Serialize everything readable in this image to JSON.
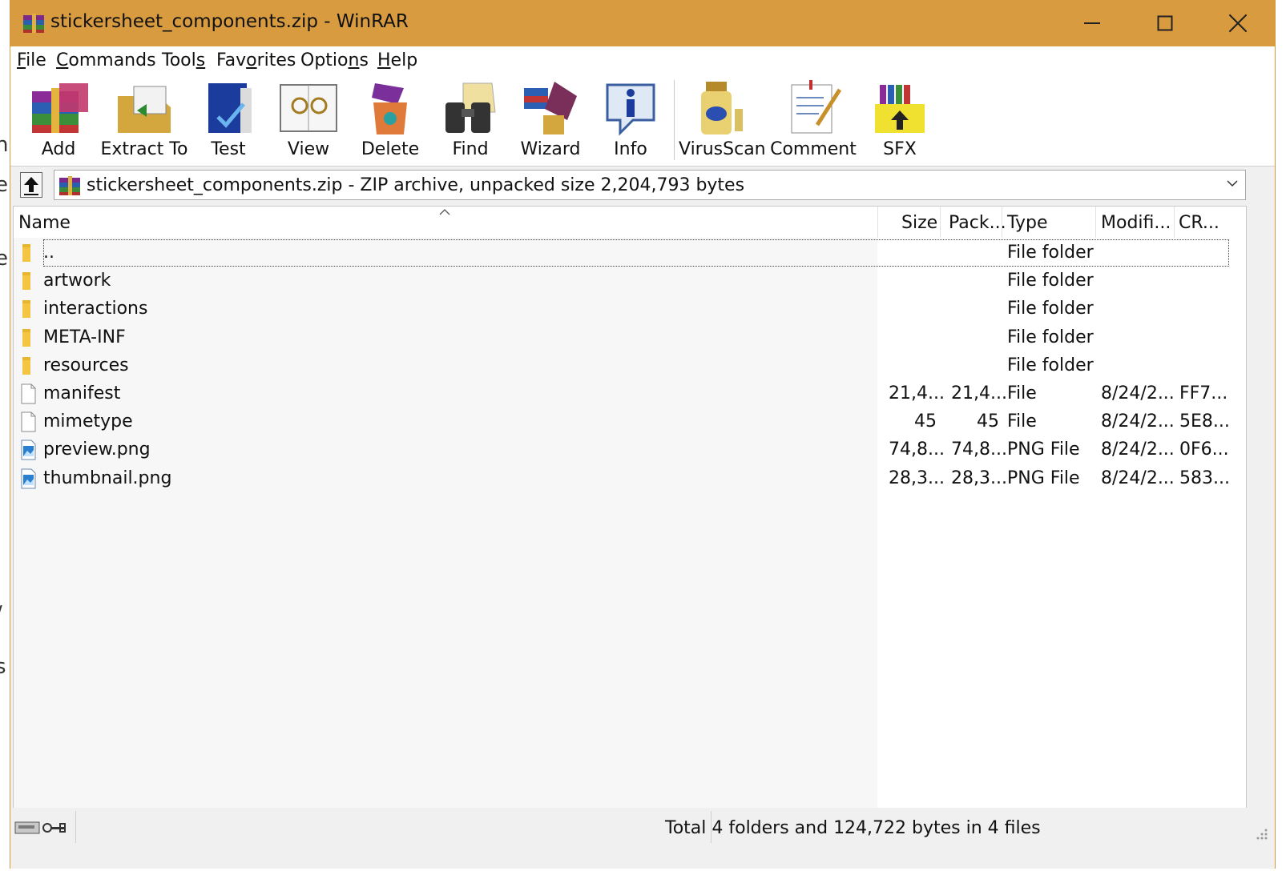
{
  "window": {
    "title": "stickersheet_components.zip - WinRAR"
  },
  "menu": [
    {
      "label": "File",
      "ul": "F",
      "rest": "ile"
    },
    {
      "label": "Commands",
      "ul": "C",
      "rest": "ommands"
    },
    {
      "label": "Tools",
      "pre": "Tool",
      "ul": "s",
      "rest": ""
    },
    {
      "label": "Favorites",
      "pre": "Fav",
      "ul": "o",
      "rest": "rites"
    },
    {
      "label": "Options",
      "pre": "Optio",
      "ul": "n",
      "rest": "s"
    },
    {
      "label": "Help",
      "ul": "H",
      "rest": "elp"
    }
  ],
  "toolbar": {
    "add": "Add",
    "extract_to": "Extract To",
    "test": "Test",
    "view": "View",
    "delete": "Delete",
    "find": "Find",
    "wizard": "Wizard",
    "info": "Info",
    "virusscan": "VirusScan",
    "comment": "Comment",
    "sfx": "SFX"
  },
  "address": {
    "text": "stickersheet_components.zip - ZIP archive, unpacked size 2,204,793 bytes"
  },
  "columns": {
    "name": "Name",
    "size": "Size",
    "packed": "Pack...",
    "type": "Type",
    "modified": "Modifi...",
    "crc": "CR..."
  },
  "files": [
    {
      "name": "..",
      "size": "",
      "packed": "",
      "type": "File folder",
      "modified": "",
      "crc": "",
      "icon": "folder-icon"
    },
    {
      "name": "artwork",
      "size": "",
      "packed": "",
      "type": "File folder",
      "modified": "",
      "crc": "",
      "icon": "folder-icon"
    },
    {
      "name": "interactions",
      "size": "",
      "packed": "",
      "type": "File folder",
      "modified": "",
      "crc": "",
      "icon": "folder-icon"
    },
    {
      "name": "META-INF",
      "size": "",
      "packed": "",
      "type": "File folder",
      "modified": "",
      "crc": "",
      "icon": "folder-icon"
    },
    {
      "name": "resources",
      "size": "",
      "packed": "",
      "type": "File folder",
      "modified": "",
      "crc": "",
      "icon": "folder-icon"
    },
    {
      "name": "manifest",
      "size": "21,4...",
      "packed": "21,4...",
      "type": "File",
      "modified": "8/24/2...",
      "crc": "FF7...",
      "icon": "file-icon"
    },
    {
      "name": "mimetype",
      "size": "45",
      "packed": "45",
      "type": "File",
      "modified": "8/24/2...",
      "crc": "5E8...",
      "icon": "file-icon"
    },
    {
      "name": "preview.png",
      "size": "74,8...",
      "packed": "74,8...",
      "type": "PNG File",
      "modified": "8/24/2...",
      "crc": "0F6...",
      "icon": "image-file-icon"
    },
    {
      "name": "thumbnail.png",
      "size": "28,3...",
      "packed": "28,3...",
      "type": "PNG File",
      "modified": "8/24/2...",
      "crc": "583...",
      "icon": "image-file-icon"
    }
  ],
  "status": {
    "text": "Total 4 folders and 124,722 bytes in 4 files"
  },
  "colors": {
    "titlebar": "#d99b40",
    "list_bg": "#f7f7f7",
    "window_bg": "#f0f0f0"
  }
}
